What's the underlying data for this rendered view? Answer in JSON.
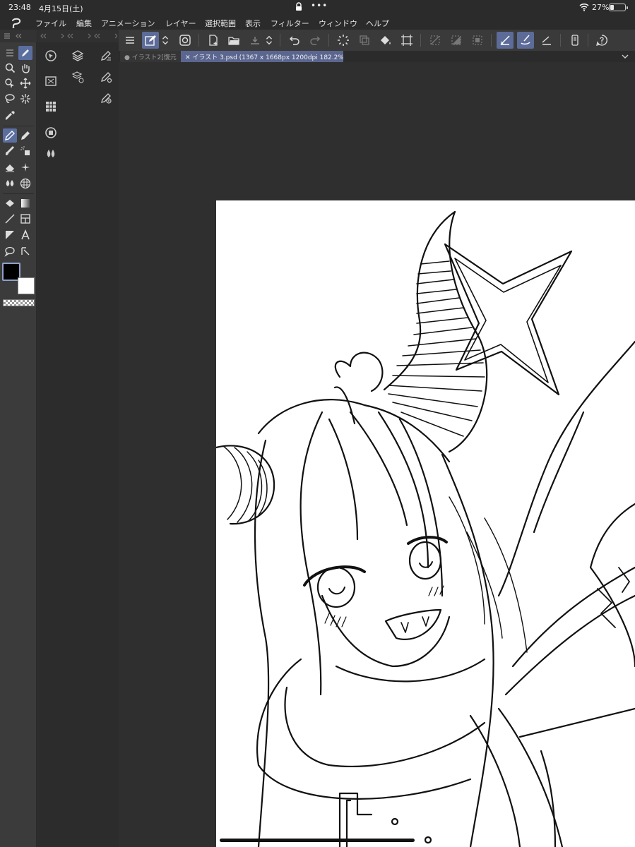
{
  "status_bar": {
    "time": "23:48",
    "date": "4月15日(土)",
    "dots": "•••",
    "battery": "27%",
    "battery_level": 0.27
  },
  "menu": {
    "items": [
      "ファイル",
      "編集",
      "アニメーション",
      "レイヤー",
      "選択範囲",
      "表示",
      "フィルター",
      "ウィンドウ",
      "ヘルプ"
    ]
  },
  "tabs": {
    "inactive": "● イラスト2[復元",
    "active": "✕ イラスト 3.psd (1367 x 1668px 1200dpi 182.2%)"
  },
  "colors": {
    "accent": "#5c6b98",
    "main_color": "#000000",
    "sub_color": "#ffffff",
    "canvas": "#ffffff"
  }
}
